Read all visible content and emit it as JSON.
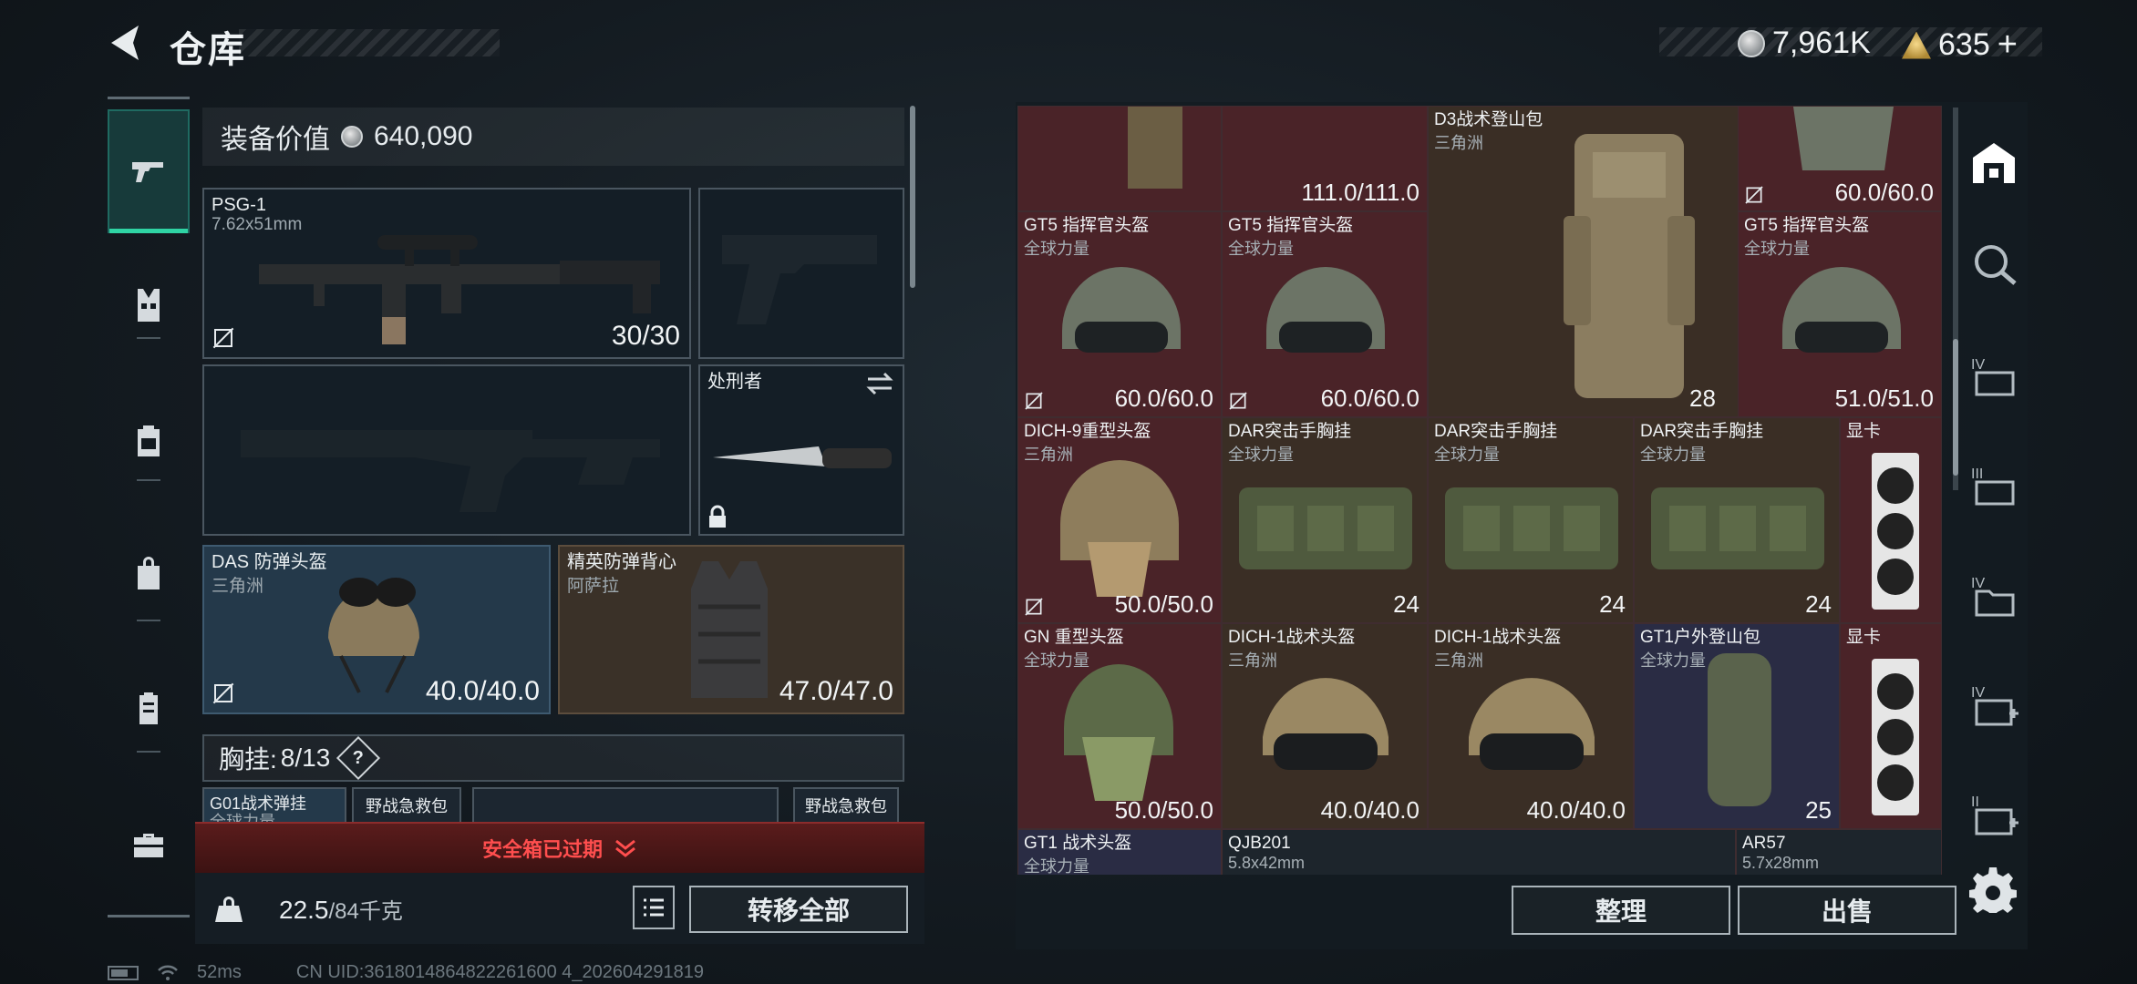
{
  "header": {
    "title": "仓库",
    "currency_1": "7,961K",
    "currency_2": "635",
    "currency_2_add": "+"
  },
  "equipment": {
    "value_label": "装备价值",
    "value": "640,090",
    "primary": {
      "name": "PSG-1",
      "caliber": "7.62x51mm",
      "durability": "30/30"
    },
    "melee": {
      "name": "处刑者"
    },
    "helmet": {
      "name": "DAS 防弹头盔",
      "origin": "三角洲",
      "durability": "40.0/40.0"
    },
    "armor": {
      "name": "精英防弹背心",
      "origin": "阿萨拉",
      "durability": "47.0/47.0"
    },
    "chest_label": "胸挂:",
    "chest_used": "8",
    "chest_total": "/13",
    "chest_help": "?",
    "mini_slots": [
      {
        "name": "G01战术弹挂",
        "origin": "全球力量"
      },
      {
        "name": "野战急救包"
      },
      {
        "name": "野战急救包"
      }
    ],
    "safebox_expired": "安全箱已过期",
    "weight_current": "22.5",
    "weight_max": "/84千克",
    "transfer_all": "转移全部"
  },
  "stash": {
    "items": [
      {
        "name": "",
        "origin": "",
        "value": "111.0/111.0"
      },
      {
        "name": "D3战术登山包",
        "origin": "三角洲",
        "value": "28"
      },
      {
        "name": "",
        "origin": "",
        "value": "60.0/60.0"
      },
      {
        "name": "GT5 指挥官头盔",
        "origin": "全球力量",
        "value": "60.0/60.0"
      },
      {
        "name": "GT5 指挥官头盔",
        "origin": "全球力量",
        "value": "60.0/60.0"
      },
      {
        "name": "GT5 指挥官头盔",
        "origin": "全球力量",
        "value": "51.0/51.0"
      },
      {
        "name": "DICH-9重型头盔",
        "origin": "三角洲",
        "value": "50.0/50.0"
      },
      {
        "name": "DAR突击手胸挂",
        "origin": "全球力量",
        "value": "24"
      },
      {
        "name": "DAR突击手胸挂",
        "origin": "全球力量",
        "value": "24"
      },
      {
        "name": "DAR突击手胸挂",
        "origin": "全球力量",
        "value": "24"
      },
      {
        "name": "显卡",
        "origin": "",
        "value": ""
      },
      {
        "name": "GN 重型头盔",
        "origin": "全球力量",
        "value": "50.0/50.0"
      },
      {
        "name": "DICH-1战术头盔",
        "origin": "三角洲",
        "value": "40.0/40.0"
      },
      {
        "name": "DICH-1战术头盔",
        "origin": "三角洲",
        "value": "40.0/40.0"
      },
      {
        "name": "GT1户外登山包",
        "origin": "全球力量",
        "value": "25"
      },
      {
        "name": "显卡",
        "origin": "",
        "value": ""
      },
      {
        "name": "GT1 战术头盔",
        "origin": "全球力量",
        "value": ""
      },
      {
        "name": "QJB201",
        "origin": "5.8x42mm",
        "value": ""
      },
      {
        "name": "AR57",
        "origin": "5.7x28mm",
        "value": ""
      }
    ],
    "sort": "整理",
    "sell": "出售"
  },
  "status": {
    "ping": "52ms",
    "uid": "CN UID:3618014864822261600 4_202604291819"
  },
  "colors": {
    "accent": "#2fd4a4",
    "warning": "#ff4e4e",
    "red_cell": "#4a2328",
    "brown_cell": "#3a2e25",
    "purple_cell": "#2a2c44"
  },
  "icons": {
    "rail": [
      "pistol-icon",
      "vest-icon",
      "backpack-icon",
      "bag-icon",
      "clipboard-icon",
      "toolbox-icon"
    ],
    "right_rail": [
      "vault-icon",
      "search-icon",
      "tier-iv-icon",
      "tier-iii-icon",
      "tier-iv-folder-icon",
      "tier-iv-medkit-icon",
      "tier-ii-medkit-icon",
      "gear-icon"
    ]
  }
}
